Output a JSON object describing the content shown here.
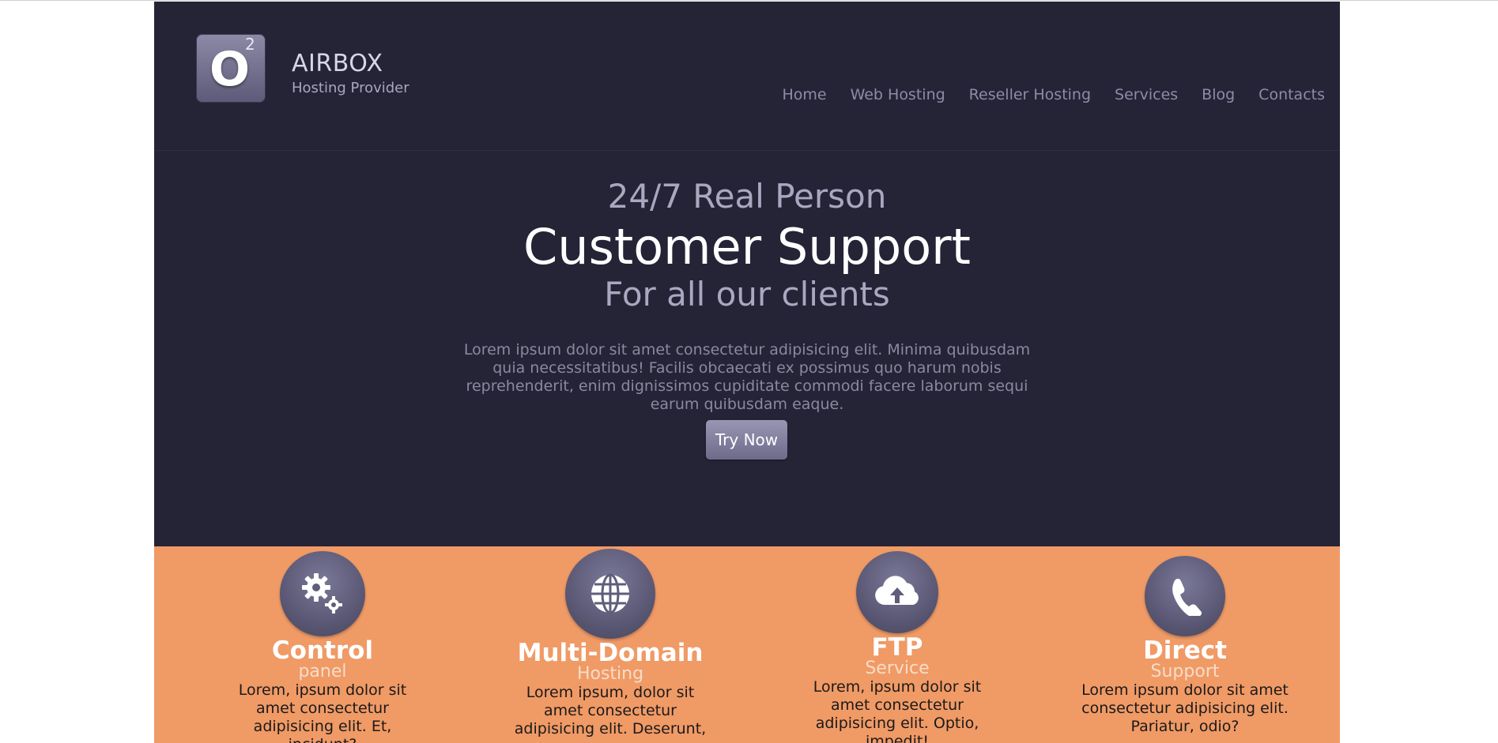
{
  "brand": {
    "logo_letter": "O",
    "logo_superscript": "2",
    "name": "AIRBOX",
    "tagline": "Hosting Provider"
  },
  "nav": {
    "items": [
      {
        "label": "Home"
      },
      {
        "label": "Web Hosting"
      },
      {
        "label": "Reseller Hosting"
      },
      {
        "label": "Services"
      },
      {
        "label": "Blog"
      },
      {
        "label": "Contacts"
      }
    ]
  },
  "hero": {
    "line1": "24/7 Real Person",
    "line2": "Customer Support",
    "line3": "For all our clients",
    "body": "Lorem ipsum dolor sit amet consectetur adipisicing elit. Minima quibusdam quia necessitatibus! Facilis obcaecati ex possimus quo harum nobis reprehenderit, enim dignissimos cupiditate commodi facere laborum sequi earum quibusdam eaque.",
    "cta_label": "Try Now"
  },
  "features": [
    {
      "icon": "gears-icon",
      "title": "Control",
      "subtitle": "panel",
      "description": "Lorem, ipsum dolor sit amet consectetur adipisicing elit. Et, incidunt?"
    },
    {
      "icon": "globe-icon",
      "title": "Multi-Domain",
      "subtitle": "Hosting",
      "description": "Lorem ipsum, dolor sit amet consectetur adipisicing elit. Deserunt, nemo."
    },
    {
      "icon": "cloud-upload-icon",
      "title": "FTP",
      "subtitle": "Service",
      "description": "Lorem, ipsum dolor sit amet consectetur adipisicing elit. Optio, impedit!"
    },
    {
      "icon": "phone-icon",
      "title": "Direct",
      "subtitle": "Support",
      "description": "Lorem ipsum dolor sit amet consectetur adipisicing elit. Pariatur, odio?"
    }
  ],
  "colors": {
    "header_bg": "#252336",
    "features_bg": "#f09a66",
    "accent": "#7a7898"
  }
}
